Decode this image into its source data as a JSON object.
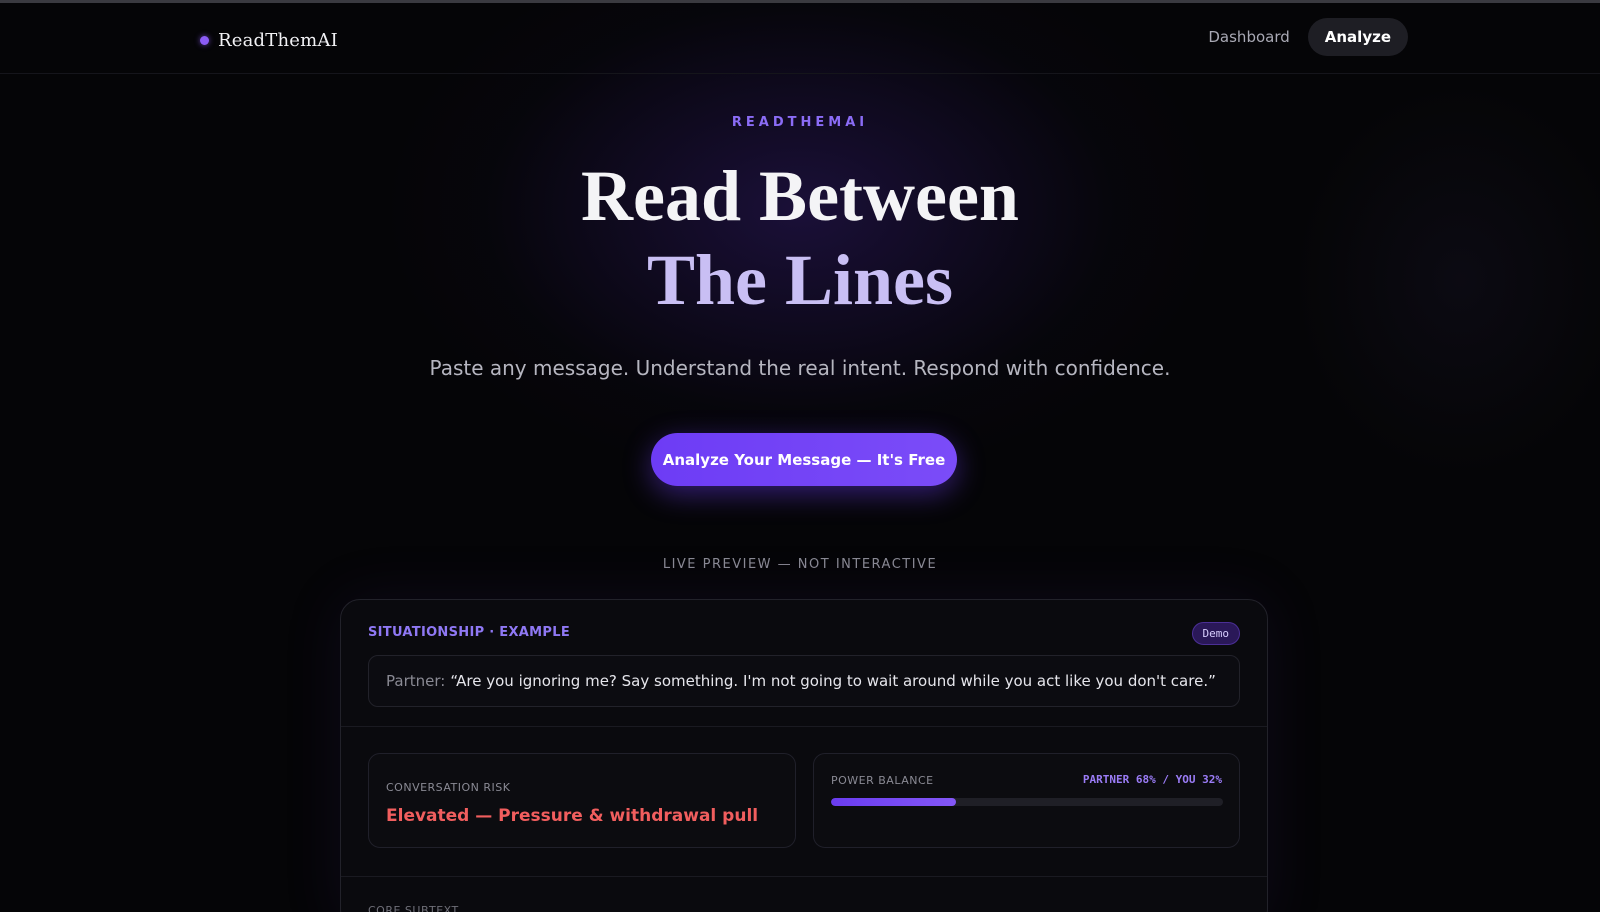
{
  "nav": {
    "brand": "ReadThemAI",
    "links": [
      {
        "label": "Dashboard"
      },
      {
        "label": "Analyze",
        "active": true
      }
    ]
  },
  "hero": {
    "eyebrow": "READTHEMAI",
    "title_line1": "Read Between",
    "title_line2": "The Lines",
    "subtitle": "Paste any message. Understand the real intent. Respond with confidence.",
    "cta_label": "Analyze Your Message — It's Free"
  },
  "preview": {
    "label": "LIVE PREVIEW — NOT INTERACTIVE",
    "card": {
      "tag": "SITUATIONSHIP · EXAMPLE",
      "badge": "Demo",
      "speaker": "Partner:",
      "quote": "“Are you ignoring me? Say something. I'm not going to wait around while you act like you don't care.”",
      "risk": {
        "label": "CONVERSATION RISK",
        "value": "Elevated — Pressure & withdrawal pull"
      },
      "power": {
        "label": "POWER BALANCE",
        "value": "PARTNER 68% / YOU 32%",
        "partner_pct": 68,
        "you_pct": 32,
        "bar_fill_pct": 32
      },
      "core_label": "CORE SUBTEXT"
    }
  },
  "colors": {
    "accent": "#7b4cf8",
    "risk": "#f15e5e",
    "background": "#050507"
  }
}
